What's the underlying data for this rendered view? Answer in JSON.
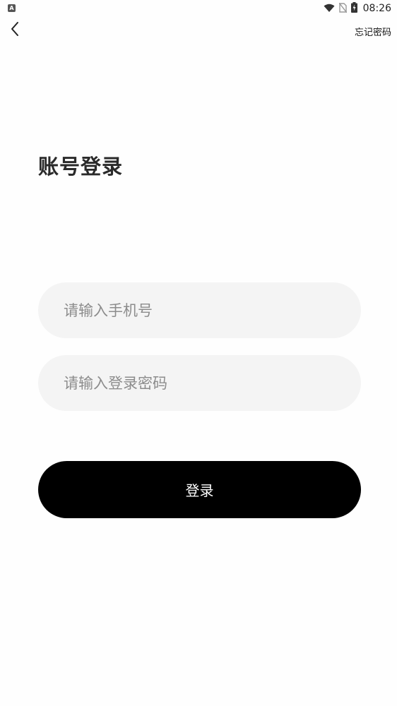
{
  "status_bar": {
    "app_icon": "A",
    "time": "08:26",
    "icons": [
      "wifi-icon",
      "no-sim-icon",
      "battery-charging-icon"
    ]
  },
  "header": {
    "back_icon": "chevron-left-icon",
    "forgot_password_label": "忘记密码"
  },
  "main": {
    "title": "账号登录",
    "phone_placeholder": "请输入手机号",
    "phone_value": "",
    "password_placeholder": "请输入登录密码",
    "password_value": "",
    "login_label": "登录"
  },
  "colors": {
    "input_bg": "#f4f4f4",
    "button_bg": "#000000",
    "button_text": "#ffffff",
    "placeholder": "#8c8c8c"
  }
}
